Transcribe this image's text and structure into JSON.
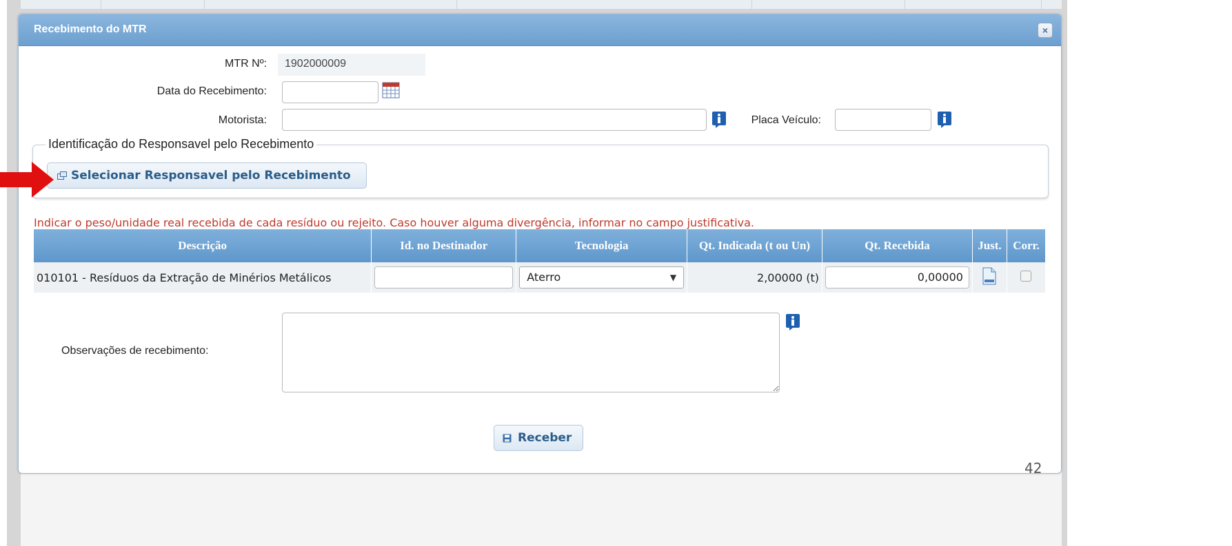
{
  "dialog": {
    "title": "Recebimento do MTR",
    "close_label": "×"
  },
  "form": {
    "mtr_label": "MTR Nº:",
    "mtr_value": "1902000009",
    "data_label": "Data do Recebimento:",
    "data_value": "",
    "motorista_label": "Motorista:",
    "motorista_value": "",
    "placa_label": "Placa Veículo:",
    "placa_value": ""
  },
  "responsavel": {
    "legend": "Identificação do Responsavel pelo Recebimento",
    "select_button": "Selecionar Responsavel pelo Recebimento"
  },
  "warning": "Indicar o peso/unidade real recebida de cada resíduo ou rejeito. Caso houver alguma divergência, informar no campo justificativa.",
  "table": {
    "headers": [
      "Descrição",
      "Id. no Destinador",
      "Tecnologia",
      "Qt. Indicada (t ou Un)",
      "Qt. Recebida",
      "Just.",
      "Corr."
    ],
    "rows": [
      {
        "descricao": "010101 - Resíduos da Extração de Minérios Metálicos",
        "id_destinador": "",
        "tecnologia": "Aterro",
        "qt_indicada": "2,00000 (t)",
        "qt_recebida": "0,00000",
        "corr_checked": false
      }
    ]
  },
  "observacoes": {
    "label": "Observações de recebimento:",
    "value": ""
  },
  "receber_button": "Receber",
  "page_number": "42",
  "colors": {
    "header_blue": "#6c9fcf",
    "warning_red": "#c0392b",
    "button_text": "#2a5d8a",
    "annotation_arrow": "#e01010"
  }
}
